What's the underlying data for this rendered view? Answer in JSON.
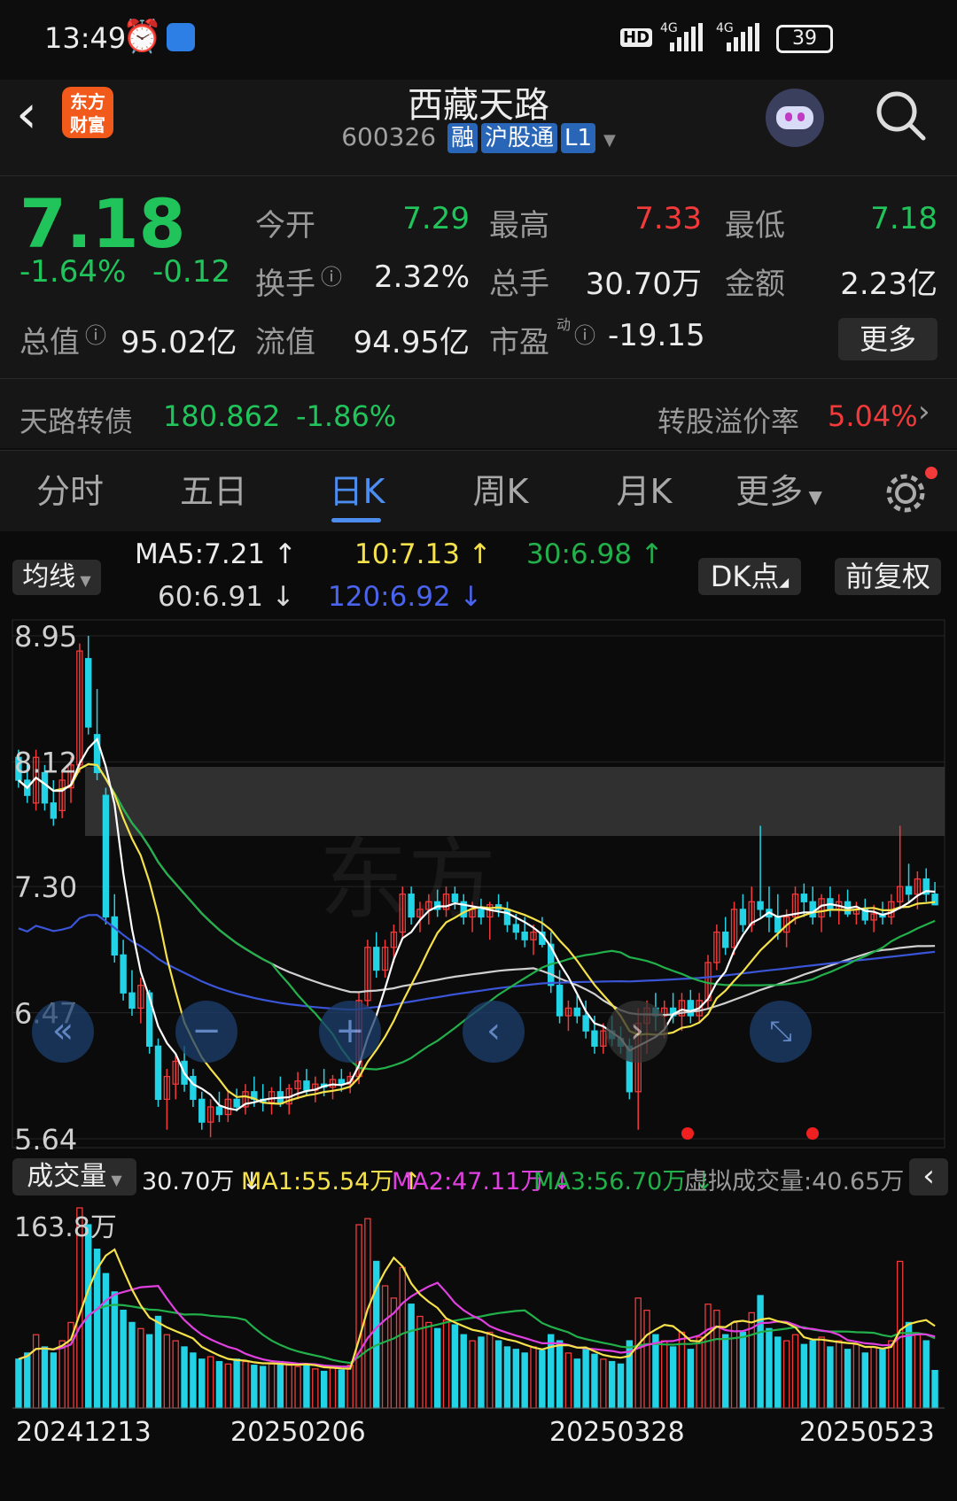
{
  "status": {
    "time": "13:49",
    "hd": "HD",
    "net1": "4G",
    "net2": "4G",
    "battery": "39"
  },
  "header": {
    "logo_line1": "东方",
    "logo_line2": "财富",
    "title": "西藏天路",
    "code": "600326",
    "badges": [
      "融",
      "沪股通",
      "L1"
    ]
  },
  "quote": {
    "price": "7.18",
    "change_pct": "-1.64%",
    "change": "-0.12",
    "open_label": "今开",
    "open": "7.29",
    "high_label": "最高",
    "high": "7.33",
    "low_label": "最低",
    "low": "7.18",
    "turnover_label": "换手",
    "turnover": "2.32%",
    "volume_label": "总手",
    "volume": "30.70万",
    "amount_label": "金额",
    "amount": "2.23亿",
    "mktcap_label": "总值",
    "mktcap": "95.02亿",
    "float_label": "流值",
    "float": "94.95亿",
    "pe_label": "市盈",
    "pe_sup": "动",
    "pe": "-19.15",
    "more": "更多",
    "bond_name": "天路转债",
    "bond_price": "180.862",
    "bond_pct": "-1.86%",
    "premium_label": "转股溢价率",
    "premium": "5.04%"
  },
  "tabs": [
    "分时",
    "五日",
    "日K",
    "周K",
    "月K",
    "更多"
  ],
  "active_tab": "日K",
  "ma_bar": {
    "selector": "均线",
    "ma5": "MA5:7.21",
    "ma10": "10:7.13",
    "ma30": "30:6.98",
    "ma60": "60:6.91",
    "ma120": "120:6.92",
    "dk": "DK点",
    "adjust": "前复权"
  },
  "vol_bar": {
    "selector": "成交量",
    "vol": "30.70万",
    "ma1": "MA1:55.54万",
    "ma2": "MA2:47.11万",
    "ma3": "MA3:56.70万",
    "virtual": "虚拟成交量:40.65万"
  },
  "colors": {
    "up": "#f23a3a",
    "down": "#22d3e6",
    "green": "#21c45a",
    "ma5": "#ffffff",
    "ma10": "#f5e14a",
    "ma30": "#22b04a",
    "ma60": "#d0d0d0",
    "ma120": "#3a55d8",
    "vma2": "#e040e0"
  },
  "chart_data": {
    "type": "candlestick",
    "y_ticks": [
      "8.95",
      "8.12",
      "7.30",
      "6.47",
      "5.64"
    ],
    "ylim": [
      5.64,
      8.95
    ],
    "x_labels": [
      "20241213",
      "20250206",
      "20250328",
      "20250523"
    ],
    "vol_max_label": "163.8万",
    "vol_ylim": [
      0,
      163.8
    ],
    "candles": [
      [
        "20241210",
        8.15,
        8.2,
        7.95,
        8.0
      ],
      [
        "20241211",
        8.0,
        8.1,
        7.85,
        7.9
      ],
      [
        "20241212",
        7.85,
        8.2,
        7.8,
        8.15
      ],
      [
        "20241213",
        8.05,
        8.1,
        7.8,
        7.85
      ],
      [
        "20241216",
        7.85,
        8.0,
        7.7,
        7.75
      ],
      [
        "20241217",
        7.8,
        8.05,
        7.75,
        8.0
      ],
      [
        "20241218",
        7.95,
        8.15,
        7.85,
        8.1
      ],
      [
        "20241219",
        8.1,
        8.9,
        8.05,
        8.85
      ],
      [
        "20241220",
        8.8,
        8.95,
        8.3,
        8.35
      ],
      [
        "20241223",
        8.3,
        8.6,
        8.0,
        8.05
      ],
      [
        "20241224",
        7.9,
        7.95,
        7.05,
        7.1
      ],
      [
        "20241225",
        7.1,
        7.25,
        6.8,
        6.85
      ],
      [
        "20241226",
        6.85,
        6.95,
        6.55,
        6.6
      ],
      [
        "20241227",
        6.6,
        6.75,
        6.45,
        6.5
      ],
      [
        "20241230",
        6.5,
        6.7,
        6.4,
        6.65
      ],
      [
        "20241231",
        6.6,
        6.62,
        6.2,
        6.25
      ],
      [
        "20250102",
        6.25,
        6.3,
        5.85,
        5.9
      ],
      [
        "20250103",
        5.9,
        6.1,
        5.7,
        6.05
      ],
      [
        "20250106",
        6.0,
        6.2,
        5.9,
        6.15
      ],
      [
        "20250107",
        6.15,
        6.25,
        5.95,
        6.0
      ],
      [
        "20250108",
        6.05,
        6.1,
        5.85,
        5.9
      ],
      [
        "20250109",
        5.9,
        5.95,
        5.7,
        5.75
      ],
      [
        "20250110",
        5.75,
        5.9,
        5.65,
        5.85
      ],
      [
        "20250113",
        5.85,
        5.95,
        5.75,
        5.8
      ],
      [
        "20250114",
        5.8,
        5.95,
        5.75,
        5.9
      ],
      [
        "20250115",
        5.9,
        5.97,
        5.82,
        5.85
      ],
      [
        "20250116",
        5.85,
        6.0,
        5.8,
        5.95
      ],
      [
        "20250117",
        5.95,
        6.05,
        5.85,
        5.9
      ],
      [
        "20250120",
        5.9,
        6.0,
        5.82,
        5.88
      ],
      [
        "20250121",
        5.88,
        5.98,
        5.8,
        5.95
      ],
      [
        "20250122",
        5.95,
        6.05,
        5.85,
        5.87
      ],
      [
        "20250123",
        5.87,
        6.0,
        5.8,
        5.97
      ],
      [
        "20250124",
        5.97,
        6.08,
        5.9,
        6.02
      ],
      [
        "20250127",
        6.02,
        6.1,
        5.92,
        5.96
      ],
      [
        "20250205",
        5.96,
        6.05,
        5.88,
        6.0
      ],
      [
        "20250206",
        6.0,
        6.1,
        5.92,
        5.98
      ],
      [
        "20250207",
        5.98,
        6.06,
        5.9,
        6.03
      ],
      [
        "20250210",
        6.03,
        6.1,
        5.95,
        6.0
      ],
      [
        "20250211",
        6.0,
        6.08,
        5.94,
        6.05
      ],
      [
        "20250212",
        6.05,
        6.6,
        6.0,
        6.55
      ],
      [
        "20250213",
        6.55,
        6.95,
        6.5,
        6.9
      ],
      [
        "20250214",
        6.9,
        7.0,
        6.7,
        6.75
      ],
      [
        "20250217",
        6.75,
        6.95,
        6.7,
        6.9
      ],
      [
        "20250218",
        6.9,
        7.05,
        6.8,
        7.0
      ],
      [
        "20250219",
        7.0,
        7.3,
        6.95,
        7.25
      ],
      [
        "20250220",
        7.25,
        7.3,
        7.05,
        7.1
      ],
      [
        "20250221",
        7.1,
        7.2,
        7.0,
        7.15
      ],
      [
        "20250224",
        7.15,
        7.25,
        7.05,
        7.2
      ],
      [
        "20250225",
        7.2,
        7.28,
        7.1,
        7.15
      ],
      [
        "20250226",
        7.15,
        7.3,
        7.1,
        7.25
      ],
      [
        "20250227",
        7.25,
        7.3,
        7.15,
        7.2
      ],
      [
        "20250228",
        7.2,
        7.25,
        7.05,
        7.1
      ],
      [
        "20250303",
        7.1,
        7.2,
        7.0,
        7.15
      ],
      [
        "20250304",
        7.15,
        7.22,
        7.05,
        7.1
      ],
      [
        "20250305",
        7.1,
        7.2,
        6.95,
        7.18
      ],
      [
        "20250306",
        7.18,
        7.25,
        7.1,
        7.15
      ],
      [
        "20250307",
        7.15,
        7.2,
        7.0,
        7.05
      ],
      [
        "20250310",
        7.05,
        7.12,
        6.95,
        7.0
      ],
      [
        "20250311",
        7.0,
        7.1,
        6.9,
        6.95
      ],
      [
        "20250312",
        6.95,
        7.05,
        6.85,
        7.0
      ],
      [
        "20250313",
        7.0,
        7.1,
        6.9,
        6.92
      ],
      [
        "20250314",
        6.92,
        7.0,
        6.6,
        6.65
      ],
      [
        "20250317",
        6.65,
        6.75,
        6.4,
        6.45
      ],
      [
        "20250318",
        6.45,
        6.55,
        6.35,
        6.5
      ],
      [
        "20250319",
        6.5,
        6.6,
        6.4,
        6.45
      ],
      [
        "20250320",
        6.45,
        6.55,
        6.3,
        6.35
      ],
      [
        "20250321",
        6.35,
        6.45,
        6.2,
        6.25
      ],
      [
        "20250324",
        6.25,
        6.4,
        6.2,
        6.35
      ],
      [
        "20250325",
        6.35,
        6.45,
        6.25,
        6.3
      ],
      [
        "20250326",
        6.3,
        6.38,
        6.2,
        6.25
      ],
      [
        "20250327",
        6.25,
        6.3,
        5.9,
        5.95
      ],
      [
        "20250328",
        5.95,
        6.5,
        5.7,
        6.4
      ],
      [
        "20250331",
        6.4,
        6.55,
        6.2,
        6.5
      ],
      [
        "20250401",
        6.5,
        6.6,
        6.35,
        6.45
      ],
      [
        "20250402",
        6.45,
        6.55,
        6.3,
        6.5
      ],
      [
        "20250403",
        6.5,
        6.6,
        6.4,
        6.45
      ],
      [
        "20250407",
        6.45,
        6.6,
        6.35,
        6.55
      ],
      [
        "20250408",
        6.55,
        6.62,
        6.4,
        6.45
      ],
      [
        "20250409",
        6.45,
        6.6,
        6.4,
        6.55
      ],
      [
        "20250410",
        6.55,
        6.85,
        6.5,
        6.8
      ],
      [
        "20250411",
        6.8,
        7.05,
        6.75,
        7.0
      ],
      [
        "20250414",
        7.0,
        7.1,
        6.85,
        6.9
      ],
      [
        "20250415",
        6.9,
        7.2,
        6.85,
        7.15
      ],
      [
        "20250416",
        7.15,
        7.25,
        7.0,
        7.05
      ],
      [
        "20250417",
        7.05,
        7.3,
        7.0,
        7.2
      ],
      [
        "20250418",
        7.2,
        7.7,
        7.1,
        7.15
      ],
      [
        "20250421",
        7.15,
        7.3,
        7.0,
        7.1
      ],
      [
        "20250422",
        7.1,
        7.25,
        6.95,
        7.0
      ],
      [
        "20250423",
        7.0,
        7.15,
        6.9,
        7.1
      ],
      [
        "20250424",
        7.1,
        7.3,
        7.05,
        7.25
      ],
      [
        "20250425",
        7.25,
        7.32,
        7.1,
        7.2
      ],
      [
        "20250428",
        7.2,
        7.3,
        7.05,
        7.1
      ],
      [
        "20250429",
        7.1,
        7.25,
        7.0,
        7.22
      ],
      [
        "20250430",
        7.22,
        7.3,
        7.1,
        7.15
      ],
      [
        "20250506",
        7.15,
        7.25,
        7.05,
        7.2
      ],
      [
        "20250507",
        7.2,
        7.28,
        7.1,
        7.12
      ],
      [
        "20250508",
        7.12,
        7.2,
        7.05,
        7.15
      ],
      [
        "20250509",
        7.15,
        7.22,
        7.05,
        7.08
      ],
      [
        "20250512",
        7.08,
        7.18,
        7.0,
        7.12
      ],
      [
        "20250513",
        7.12,
        7.2,
        7.05,
        7.1
      ],
      [
        "20250514",
        7.1,
        7.25,
        7.05,
        7.2
      ],
      [
        "20250515",
        7.2,
        7.7,
        7.15,
        7.3
      ],
      [
        "20250516",
        7.3,
        7.45,
        7.2,
        7.25
      ],
      [
        "20250519",
        7.25,
        7.4,
        7.15,
        7.35
      ],
      [
        "20250520",
        7.35,
        7.42,
        7.2,
        7.25
      ],
      [
        "20250521",
        7.25,
        7.33,
        7.18,
        7.18
      ]
    ],
    "volumes": [
      40,
      45,
      60,
      50,
      45,
      55,
      70,
      163.8,
      150,
      130,
      110,
      95,
      80,
      70,
      65,
      60,
      75,
      60,
      55,
      50,
      45,
      40,
      42,
      38,
      36,
      40,
      38,
      35,
      34,
      36,
      38,
      35,
      34,
      36,
      32,
      30,
      33,
      31,
      35,
      150,
      155,
      120,
      100,
      90,
      115,
      85,
      75,
      70,
      65,
      72,
      68,
      60,
      55,
      58,
      62,
      55,
      50,
      48,
      45,
      50,
      47,
      60,
      55,
      45,
      40,
      48,
      44,
      40,
      38,
      36,
      55,
      90,
      80,
      60,
      55,
      50,
      62,
      48,
      58,
      85,
      80,
      60,
      70,
      62,
      78,
      92,
      65,
      58,
      55,
      60,
      52,
      55,
      58,
      50,
      55,
      48,
      52,
      45,
      50,
      48,
      55,
      120,
      70,
      60,
      55,
      30.7
    ]
  }
}
